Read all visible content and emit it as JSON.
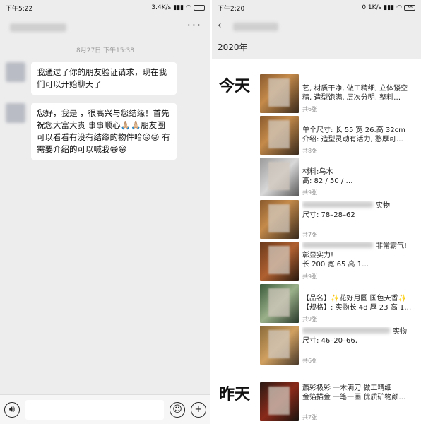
{
  "left": {
    "status": {
      "time": "下午5:22",
      "speed": "3.4K/s",
      "battery": ""
    },
    "timestamp": "8月27日 下午15:38",
    "messages": [
      "我通过了你的朋友验证请求，现在我们可以开始聊天了",
      "您好，我是 ，很高兴与您结缘！首先祝您大富大贵 事事顺心🙏🏼🙏🏼朋友圈可以看看有没有结缘的物件哈😜😜 有需要介绍的可以喊我😁😁"
    ]
  },
  "right": {
    "status": {
      "time": "下午2:20",
      "speed": "0.1K/s",
      "battery": "36"
    },
    "year": "2020年",
    "today_label": "今天",
    "yesterday_label": "昨天",
    "posts": [
      {
        "line1": "艺, 材质干净, 做工精细, 立体镂空",
        "line2": "精, 造型饱满, 层次分明, 整料…",
        "count": "共6张"
      },
      {
        "line1": "单个尺寸: 长 55 宽 26.高 32cm",
        "line2": "介绍: 造型灵动有活力, 憨厚可…",
        "count": "共8张"
      },
      {
        "line1": "材料:乌木",
        "line2": "高: 82 / 50 / …",
        "count": "共9张"
      },
      {
        "line1": "实物",
        "line2": "尺寸: 78–28–62",
        "count": "共7张"
      },
      {
        "line1": "非常霸气!",
        "line2": "彰显实力!",
        "line3": "长 200 宽 65 高 1…",
        "count": "共9张"
      },
      {
        "line1": "【品名】✨花好月圆  国色天香✨",
        "line2": "【规格】: 实物长 48 厚 23 高 1…",
        "count": "共9张"
      },
      {
        "line1": "实物",
        "line2": "尺寸: 46–20–66,",
        "count": "共6张"
      },
      {
        "line1": "蕭彩极彩 一木满刀  做工精细",
        "line2": "金箔描金 一笔一画  优质矿物颜…",
        "count": "共7张"
      }
    ]
  }
}
